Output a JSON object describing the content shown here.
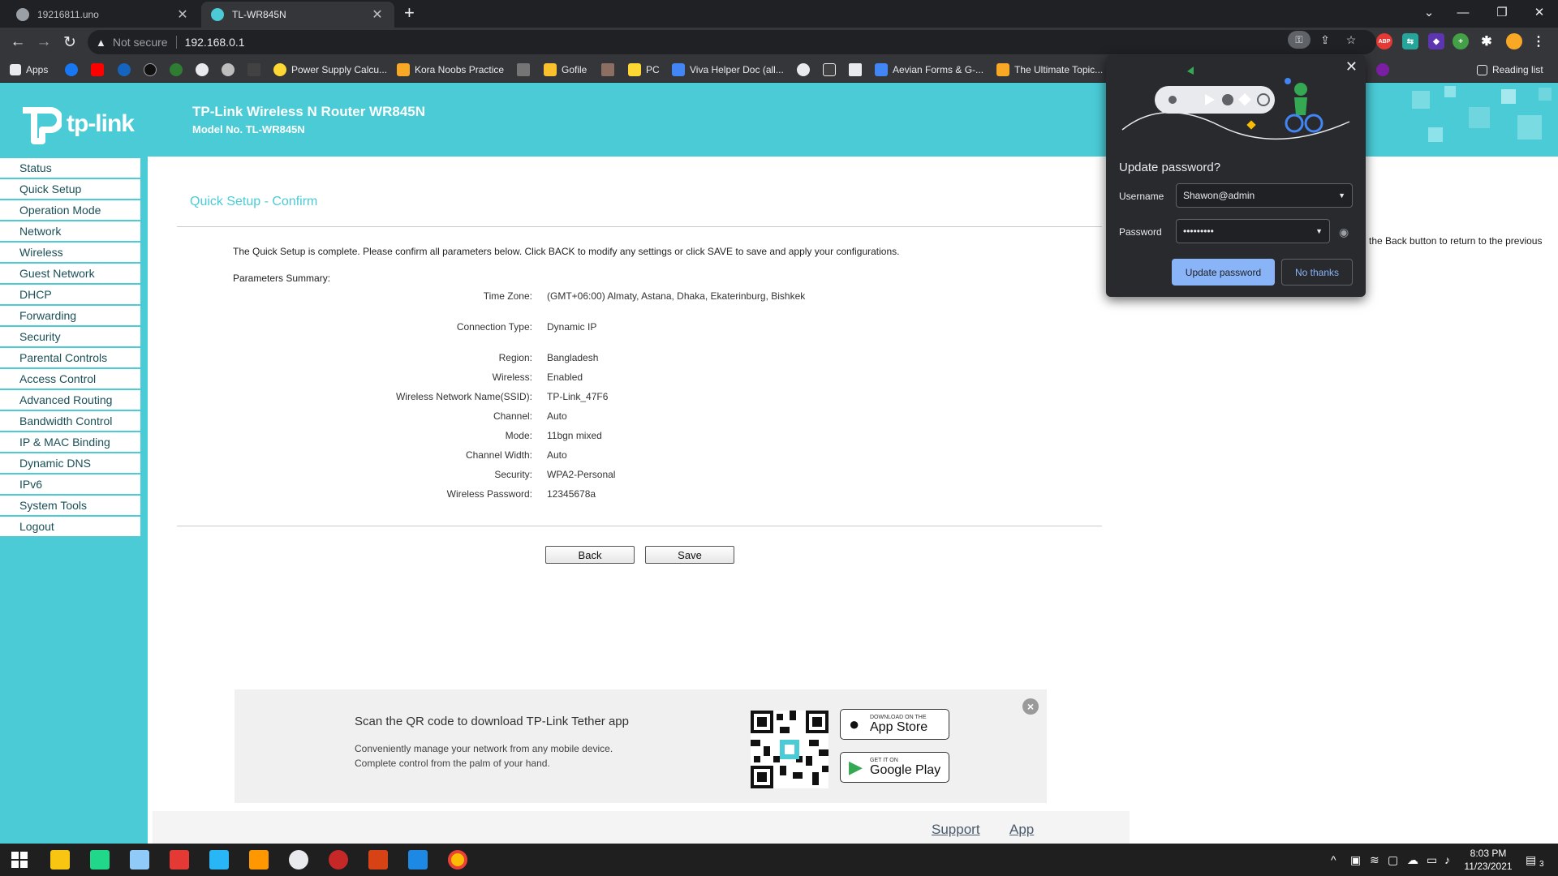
{
  "browser": {
    "tabs": [
      {
        "title": "19216811.uno",
        "active": false
      },
      {
        "title": "TL-WR845N",
        "active": true
      }
    ],
    "new_tab": "+",
    "security_label": "Not secure",
    "url": "192.168.0.1",
    "reading_list": "Reading list",
    "bookmarks": [
      "Apps",
      "Power Supply Calcu...",
      "Kora Noobs Practice",
      "Gofile",
      "PC",
      "Viva Helper Doc (all...",
      "Aevian Forms & G-...",
      "The Ultimate Topic..."
    ]
  },
  "router": {
    "brand": "tp-link",
    "title": "TP-Link Wireless N Router WR845N",
    "model": "Model No. TL-WR845N"
  },
  "menu": [
    "Status",
    "Quick Setup",
    "Operation Mode",
    "Network",
    "Wireless",
    "Guest Network",
    "DHCP",
    "Forwarding",
    "Security",
    "Parental Controls",
    "Access Control",
    "Advanced Routing",
    "Bandwidth Control",
    "IP & MAC Binding",
    "Dynamic DNS",
    "IPv6",
    "System Tools",
    "Logout"
  ],
  "main": {
    "section_title": "Quick Setup - Confirm",
    "intro": "The Quick Setup is complete. Please confirm all parameters below. Click BACK to modify any settings or click SAVE to save and apply your configurations.",
    "summary_label": "Parameters Summary:",
    "params": [
      {
        "label": "Time Zone:",
        "value": "(GMT+06:00) Almaty, Astana, Dhaka, Ekaterinburg, Bishkek"
      },
      {
        "label": "Connection Type:",
        "value": "Dynamic IP"
      },
      {
        "label": "Region:",
        "value": "Bangladesh"
      },
      {
        "label": "Wireless:",
        "value": "Enabled"
      },
      {
        "label": "Wireless Network Name(SSID):",
        "value": "TP-Link_47F6"
      },
      {
        "label": "Channel:",
        "value": "Auto"
      },
      {
        "label": "Mode:",
        "value": "11bgn mixed"
      },
      {
        "label": "Channel Width:",
        "value": "Auto"
      },
      {
        "label": "Security:",
        "value": "WPA2-Personal"
      },
      {
        "label": "Wireless Password:",
        "value": "12345678a"
      }
    ],
    "back_label": "Back",
    "save_label": "Save",
    "help_fragment": "the Back button to return to the previous"
  },
  "qr_panel": {
    "heading": "Scan the QR code to download TP-Link Tether app",
    "line1": "Conveniently manage your network from any mobile device.",
    "line2": "Complete control from the palm of your hand.",
    "app_store_small": "DOWNLOAD ON THE",
    "app_store_big": "App Store",
    "play_small": "GET IT ON",
    "play_big": "Google Play"
  },
  "footer": {
    "support": "Support",
    "app": "App"
  },
  "password_dialog": {
    "title": "Update password?",
    "username_label": "Username",
    "username_value": "Shawon@admin",
    "password_label": "Password",
    "password_value": "•••••••••",
    "update_label": "Update password",
    "nothanks_label": "No thanks"
  },
  "taskbar": {
    "time": "8:03 PM",
    "date": "11/23/2021",
    "notifications": "3"
  },
  "colors": {
    "tp_teal": "#4acbd6",
    "chrome_dark": "#202124",
    "chrome_toolbar": "#35363a",
    "dialog_accent": "#8ab4f8"
  }
}
